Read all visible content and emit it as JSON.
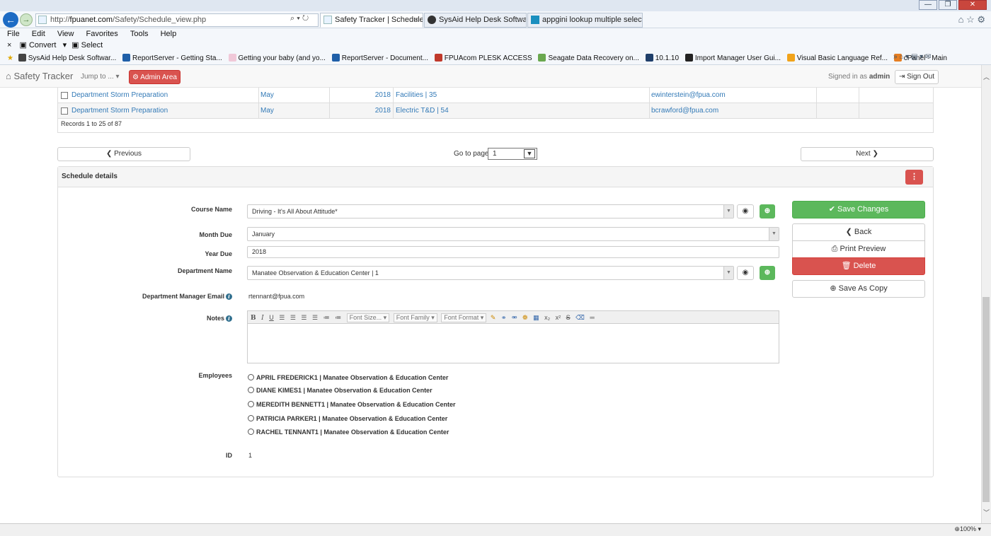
{
  "browser": {
    "url_prefix": "http://",
    "url_domain": "fpuanet.com",
    "url_path": "/Safety/Schedule_view.php",
    "url_controls": "⌕ ▾ ↻",
    "tabs": [
      {
        "label": "Safety Tracker | Schedule",
        "close": "×"
      },
      {
        "label": "SysAid Help Desk Software"
      },
      {
        "label": "appgini lookup multiple selecti..."
      }
    ],
    "menu": [
      "File",
      "Edit",
      "View",
      "Favorites",
      "Tools",
      "Help"
    ],
    "command_bar": {
      "close": "×",
      "convert": "Convert",
      "select": "Select"
    },
    "favorites": [
      {
        "label": "SysAid Help Desk Softwar...",
        "color": "#444444"
      },
      {
        "label": "ReportServer - Getting Sta...",
        "color": "#1f5fa8"
      },
      {
        "label": "Getting your baby (and yo...",
        "color": "#f0c8d8"
      },
      {
        "label": "ReportServer - Document...",
        "color": "#1f5fa8"
      },
      {
        "label": "FPUAcom PLESK ACCESS",
        "color": "#c0392b"
      },
      {
        "label": "Seagate Data Recovery on...",
        "color": "#6aa84f"
      },
      {
        "label": "10.1.10",
        "color": "#1f3f6a"
      },
      {
        "label": "Import Manager User Gui...",
        "color": "#222222"
      },
      {
        "label": "Visual Basic Language Ref...",
        "color": "#f1a31b"
      },
      {
        "label": "cPanel - Main",
        "color": "#e67e22"
      }
    ],
    "zoom": "100%"
  },
  "navbar": {
    "brand": "Safety Tracker",
    "jump": "Jump to ...",
    "admin": "Admin Area",
    "signed_in_prefix": "Signed in as ",
    "signed_in_user": "admin",
    "sign_out": "Sign Out"
  },
  "table": {
    "rows": [
      {
        "course": "Department Storm Preparation",
        "month": "May",
        "year": "2018",
        "dept": "Facilities | 35",
        "email": "ewinterstein@fpua.com"
      },
      {
        "course": "Department Storm Preparation",
        "month": "May",
        "year": "2018",
        "dept": "Electric T&D | 54",
        "email": "bcrawford@fpua.com"
      }
    ],
    "records": "Records 1 to 25 of 87"
  },
  "pager": {
    "previous": "Previous",
    "next": "Next",
    "goto_label": "Go to page:",
    "page": "1"
  },
  "details": {
    "title": "Schedule details",
    "course_label": "Course Name",
    "course_value": "Driving - It's All About Attitude*",
    "month_label": "Month Due",
    "month_value": "January",
    "year_label": "Year Due",
    "year_value": "2018",
    "dept_label": "Department Name",
    "dept_value": "Manatee Observation & Education Center | 1",
    "mgr_email_label": "Department Manager Email",
    "mgr_email_value": "rtennant@fpua.com",
    "notes_label": "Notes",
    "editor_font_size": "Font Size...",
    "editor_font_family": "Font Family",
    "editor_font_format": "Font Format",
    "employees_label": "Employees",
    "employees": [
      "APRIL FREDERICK1 | Manatee Observation & Education Center",
      "DIANE KIMES1 | Manatee Observation & Education Center",
      "MEREDITH BENNETT1 | Manatee Observation & Education Center",
      "PATRICIA PARKER1 | Manatee Observation & Education Center",
      "RACHEL TENNANT1 | Manatee Observation & Education Center"
    ],
    "id_label": "ID",
    "id_value": "1"
  },
  "actions": {
    "save": "Save Changes",
    "back": "Back",
    "print": "Print Preview",
    "delete": "Delete",
    "save_copy": "Save As Copy"
  }
}
